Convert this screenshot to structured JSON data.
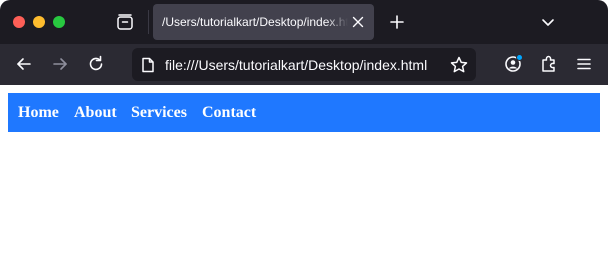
{
  "browser": {
    "tab": {
      "title": "/Users/tutorialkart/Desktop/index.html"
    },
    "address_bar": {
      "url": "file:///Users/tutorialkart/Desktop/index.html"
    },
    "icons": {
      "tab_list": "tab-list-icon",
      "close_tab": "close-icon",
      "new_tab": "plus-icon",
      "list_all_tabs": "chevron-down-icon",
      "back": "back-arrow-icon",
      "forward": "forward-arrow-icon",
      "reload": "reload-icon",
      "page_info": "page-icon",
      "bookmark": "star-icon",
      "account": "account-icon",
      "extensions": "puzzle-icon",
      "menu": "hamburger-icon"
    },
    "colors": {
      "tabbar_bg": "#1c1b22",
      "toolbar_bg": "#2b2a33",
      "active_tab_bg": "#42414d",
      "account_badge": "#00a6ff"
    }
  },
  "page": {
    "nav": {
      "background": "#1f78ff",
      "links": [
        "Home",
        "About",
        "Services",
        "Contact"
      ]
    }
  }
}
